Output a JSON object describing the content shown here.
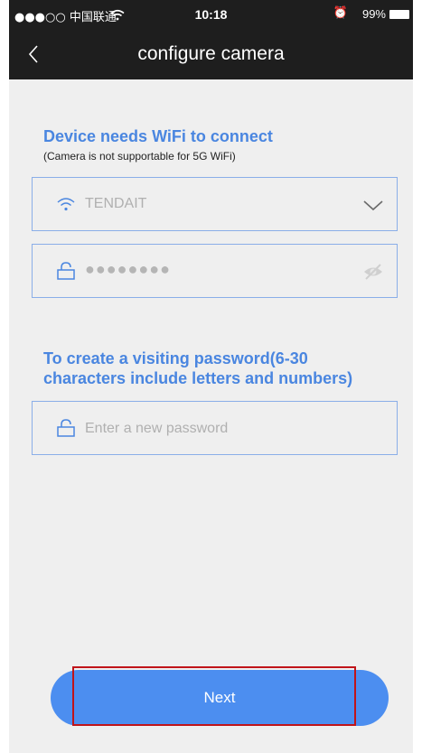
{
  "status_bar": {
    "carrier": "●●●○○ 中国联通 ",
    "time": "10:18",
    "alarm": "⏰",
    "battery": "99%"
  },
  "nav": {
    "title": "configure camera"
  },
  "wifi_section": {
    "title": "Device needs WiFi to connect",
    "subtitle": "(Camera is not supportable for 5G WiFi)",
    "ssid": "TENDAIT",
    "password_mask": "●●●●●●●●"
  },
  "visit_section": {
    "title_line1": "To create a visiting password(6-30",
    "title_line2": "characters include letters and numbers)",
    "placeholder": "Enter a new password"
  },
  "footer": {
    "next_label": "Next"
  },
  "colors": {
    "accent": "#4a86e0",
    "button": "#4c8ef0",
    "bar": "#1e1e1e",
    "highlight": "#c0141a"
  }
}
